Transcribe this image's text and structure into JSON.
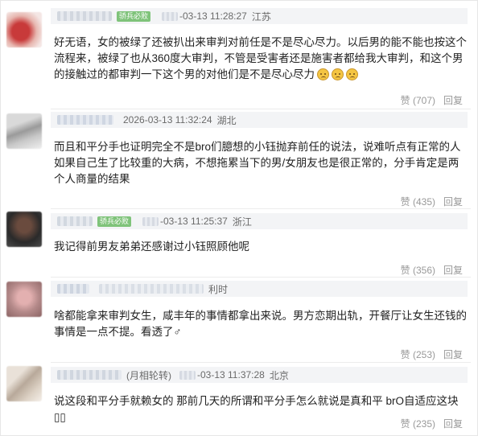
{
  "comments": [
    {
      "badge": "骄兵必败",
      "time": "-03-13 11:28:27",
      "location": "江苏",
      "text": "好无语，女的被绿了还被扒出来审判对前任是不是尽心尽力。以后男的能不能也按这个流程来，被绿了也从360度大审判，不管是受害者还是施害者都给我大审判，和这个男的接触过的都审判一下这个男的对他们是不是尽心尽力",
      "emoji": [
        "sad-face",
        "sad-face",
        "sad-face"
      ],
      "like_label": "赞",
      "like_count": "(707)",
      "reply_label": "回复"
    },
    {
      "time": "2026-03-13 11:32:24",
      "location": "湖北",
      "text": "而且和平分手也证明完全不是bro们臆想的小钰抛弃前任的说法，说难听点有正常的人如果自己生了比较重的大病，不想拖累当下的男/女朋友也是很正常的，分手肯定是两个人商量的结果",
      "like_label": "赞",
      "like_count": "(435)",
      "reply_label": "回复"
    },
    {
      "badge": "骄兵必败",
      "time": "-03-13 11:25:37",
      "location": "浙江",
      "text": "我记得前男友弟弟还感谢过小钰照顾他呢",
      "like_label": "赞",
      "like_count": "(356)",
      "reply_label": "回复"
    },
    {
      "time_suffix": "利时",
      "text": "啥都能拿来审判女生，咸丰年的事情都拿出来说。男方恋期出轨，开餐厅让女生还钱的事情是一点不提。看透了♂",
      "like_label": "赞",
      "like_count": "(253)",
      "reply_label": "回复"
    },
    {
      "tag": "(月相轮转)",
      "time": "-03-13 11:37:28",
      "location": "北京",
      "text": "说这段和平分手就赖女的 那前几天的所谓和平分手怎么就说是真和平 brO自适应这块▯▯",
      "like_label": "赞",
      "like_count": "(235)",
      "reply_label": "回复"
    }
  ],
  "colors": {
    "badge": "#7fc37a",
    "meta_bg": "#f3f4f6",
    "text": "#222222",
    "muted": "#999999"
  }
}
